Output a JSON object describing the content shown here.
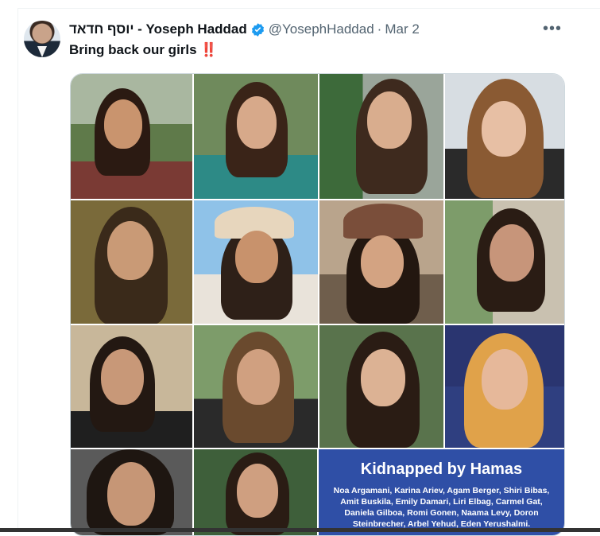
{
  "tweet": {
    "display_name": "יוסף חדאד - Yoseph Haddad",
    "handle": "@YosephHaddad",
    "separator": "·",
    "date": "Mar 2",
    "text": "Bring back our girls",
    "emoji": "‼️",
    "more_icon": "more-horizontal-icon",
    "verified_icon": "verified-badge-icon",
    "verified_color": "#1d9bf0"
  },
  "media": {
    "caption_title": "Kidnapped by Hamas",
    "caption_names": "Noa Argamani, Karina Ariev, Agam Berger, Shiri Bibas, Amit Buskila, Emily Damari, Liri Elbag, Carmel Gat, Daniela Gilboa, Romi Gonen, Naama Levy, Doron Steinbrecher, Arbel Yehud, Eden Yerushalmi.",
    "caption_bg": "#2f4fa6"
  }
}
